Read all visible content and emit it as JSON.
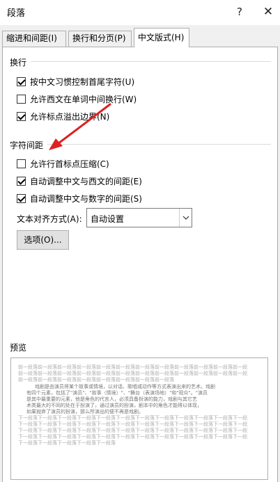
{
  "window": {
    "title": "段落",
    "help": "?",
    "close": "✕"
  },
  "tabs": [
    {
      "label": "缩进和间距(I)"
    },
    {
      "label": "换行和分页(P)"
    },
    {
      "label": "中文版式(H)"
    }
  ],
  "line_break": {
    "section": "换行",
    "options": [
      {
        "label": "按中文习惯控制首尾字符(U)",
        "checked": true
      },
      {
        "label": "允许西文在单词中间换行(W)",
        "checked": false
      },
      {
        "label": "允许标点溢出边界(N)",
        "checked": true
      }
    ]
  },
  "char_spacing": {
    "section": "字符间距",
    "options": [
      {
        "label": "允许行首标点压缩(C)",
        "checked": false
      },
      {
        "label": "自动调整中文与西文的间距(E)",
        "checked": true
      },
      {
        "label": "自动调整中文与数字的间距(S)",
        "checked": true
      }
    ],
    "align_label": "文本对齐方式(A):",
    "align_value": "自动设置",
    "options_button": "选项(O)..."
  },
  "preview": {
    "label": "预览",
    "prev_lines": [
      "前一段落前一段落前一段落前一段落前一段落前一段落前一段落前一段落前一段落前一段落前一段落前一段落前一段落",
      "前一段落前一段落前一段落前一段落前一段落前一段落前一段落前一段落前一段落前一段落前一段落前一段落前一段落",
      "前一段落前一段落前一段落前一段落前一段落前一段落前一段落前一段落"
    ],
    "body_lines": [
      "戏剧是由演员将某个故事或情境，以对话、歌唱或动作等方式表演出来的艺术。戏剧",
      "有四个元素，包括了\"演员\"、\"故事（情境）\"、\"舞台（表演场地）\"和\"观众\"。\"演员",
      "是其中最重要的元素，他是角色的代言人，必须具备扮演的能力，戏剧与其它艺",
      "术类最大的不同的处在于扮演了，通过演员的扮演，剧本中的角色才能得以体现，",
      "如果抛弃了演员的扮演，那么所演出的便不再是戏剧。"
    ],
    "next_lines": [
      "下一段落下一段落下一段落下一段落下一段落下一段落下一段落下一段落下一段落下一段落下一段落下一段落下一段落",
      "下一段落下一段落下一段落下一段落下一段落下一段落下一段落下一段落下一段落下一段落下一段落下一段落下一段落",
      "下一段落下一段落下一段落下一段落下一段落下一段落下一段落下一段落下一段落下一段落下一段落下一段落下一段落",
      "下一段落下一段落下一段落下一段落下一段落下一段落下一段落下一段落下一段落下一段落下一段落下一段落下一段落",
      "下一段落下一段落下一段落下一段落下一段落"
    ]
  },
  "colors": {
    "annotation_arrow": "#e02020"
  }
}
